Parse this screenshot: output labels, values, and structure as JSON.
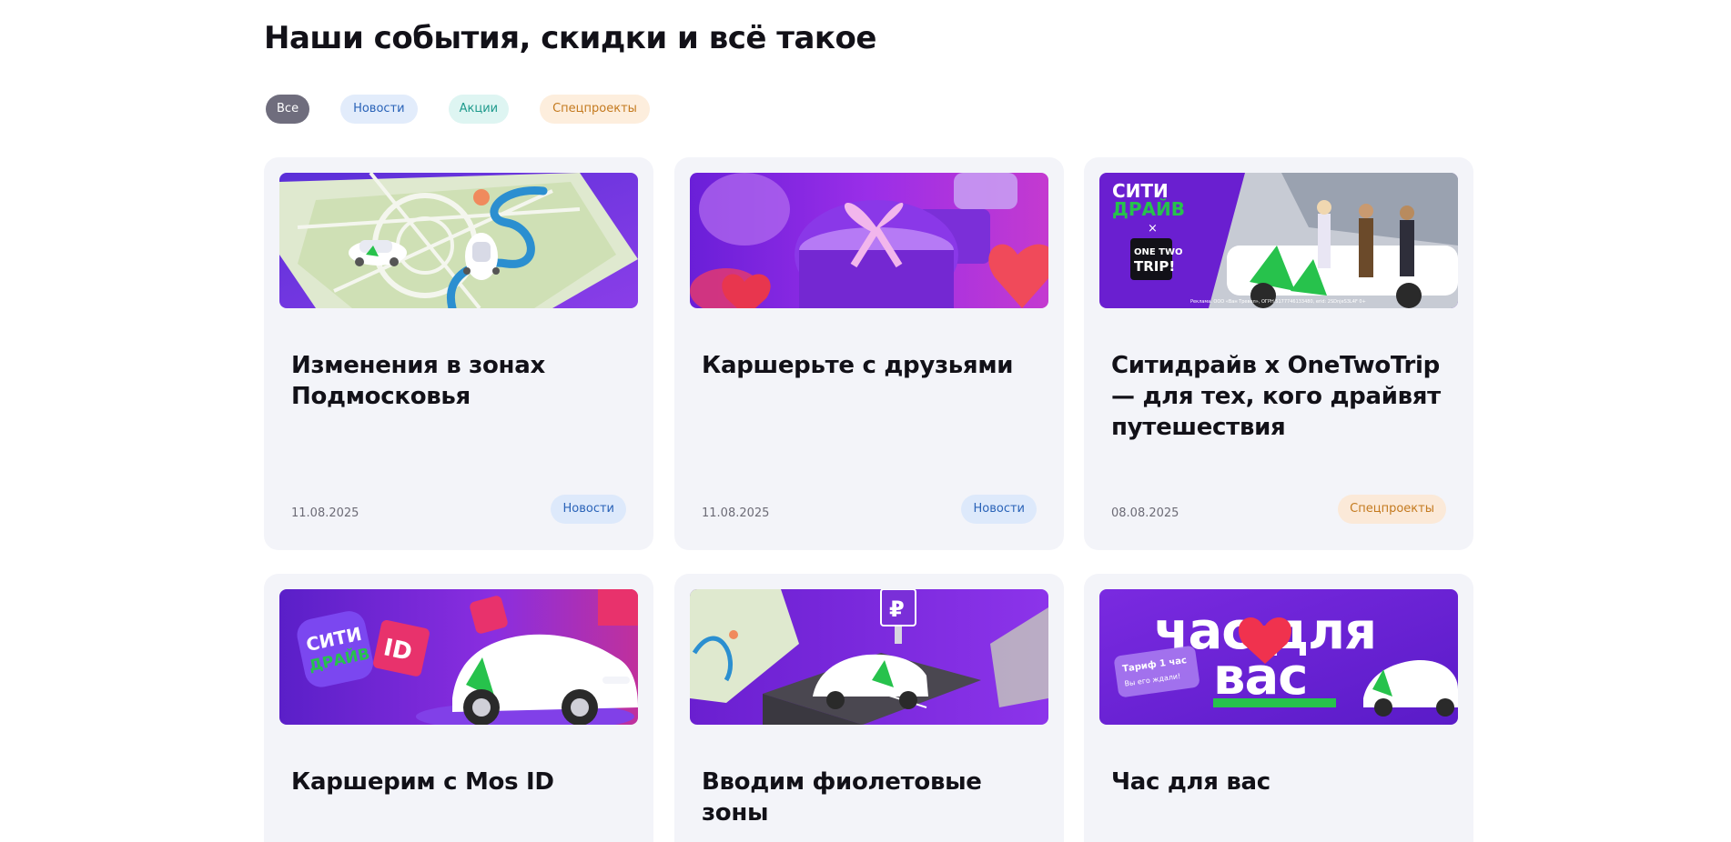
{
  "heading": "Наши события, скидки и всё такое",
  "filters": {
    "all": "Все",
    "news": "Новости",
    "promo": "Акции",
    "special": "Спецпроекты"
  },
  "cards": [
    {
      "title": "Изменения в зонах Подмосковья",
      "date": "11.08.2025",
      "tag": "Новости"
    },
    {
      "title": "Каршерьте с друзьями",
      "date": "11.08.2025",
      "tag": "Новости"
    },
    {
      "title": "Ситидрайв x OneTwoTrip — для тех, кого драйвят путешествия",
      "date": "08.08.2025",
      "tag": "Спецпроекты"
    },
    {
      "title": "Каршерим с Mos ID"
    },
    {
      "title": "Вводим фиолетовые зоны"
    },
    {
      "title": "Час для вас"
    }
  ],
  "banners": {
    "city_drive_line1": "СИТИ",
    "city_drive_line2": "ДРАЙВ",
    "times": "×",
    "onetwotrip_line1": "ONE TWO",
    "onetwotrip_line2": "TRIP!",
    "ad_disclaimer": "Реклама. ООО «Ван Тревел», ОГРН 5177746133480, erid: 2SDnjeS3L4F 0+",
    "mosid_logo_line1": "СИТИ",
    "mosid_logo_line2": "ДРАЙВ",
    "mosid_id": "ID",
    "parking_sign": "₽",
    "hour_line1": "час для",
    "hour_line2": "вас",
    "tariff_line1": "Тариф 1 час",
    "tariff_line2": "Вы его ждали!"
  },
  "colors": {
    "brand_purple": "#7a1fe0",
    "brand_green": "#27c24c",
    "card_bg": "#f3f4f9",
    "news_tag_bg": "#dde9fb",
    "special_tag_bg": "#fbe9d8"
  }
}
